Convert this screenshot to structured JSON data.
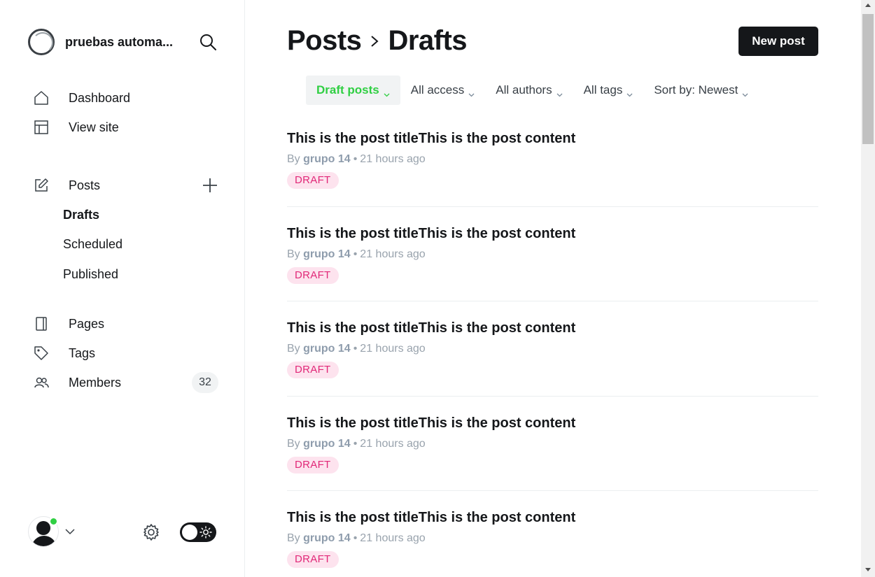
{
  "site": {
    "title": "pruebas automa..."
  },
  "nav": {
    "dashboard": {
      "label": "Dashboard",
      "icon": "home-icon"
    },
    "view_site": {
      "label": "View site",
      "icon": "layout-icon"
    },
    "posts": {
      "label": "Posts",
      "icon": "edit-icon"
    },
    "drafts": {
      "label": "Drafts"
    },
    "scheduled": {
      "label": "Scheduled"
    },
    "published": {
      "label": "Published"
    },
    "pages": {
      "label": "Pages",
      "icon": "page-icon"
    },
    "tags": {
      "label": "Tags",
      "icon": "tag-icon"
    },
    "members": {
      "label": "Members",
      "icon": "members-icon",
      "count": "32"
    }
  },
  "header": {
    "breadcrumb_parent": "Posts",
    "breadcrumb_current": "Drafts",
    "new_post_label": "New post"
  },
  "filters": [
    {
      "label": "Draft posts",
      "active": true
    },
    {
      "label": "All access",
      "active": false
    },
    {
      "label": "All authors",
      "active": false
    },
    {
      "label": "All tags",
      "active": false
    },
    {
      "label": "Sort by: Newest",
      "active": false
    }
  ],
  "posts": [
    {
      "title": "This is the post titleThis is the post content",
      "by": "By",
      "author": "grupo 14",
      "time": "21 hours ago",
      "status": "DRAFT"
    },
    {
      "title": "This is the post titleThis is the post content",
      "by": "By",
      "author": "grupo 14",
      "time": "21 hours ago",
      "status": "DRAFT"
    },
    {
      "title": "This is the post titleThis is the post content",
      "by": "By",
      "author": "grupo 14",
      "time": "21 hours ago",
      "status": "DRAFT"
    },
    {
      "title": "This is the post titleThis is the post content",
      "by": "By",
      "author": "grupo 14",
      "time": "21 hours ago",
      "status": "DRAFT"
    },
    {
      "title": "This is the post titleThis is the post content",
      "by": "By",
      "author": "grupo 14",
      "time": "21 hours ago",
      "status": "DRAFT"
    }
  ],
  "colors": {
    "accent": "#30cf43",
    "draft_badge_bg": "#fde3ee",
    "draft_badge_text": "#e12878",
    "primary_button": "#15171a"
  }
}
